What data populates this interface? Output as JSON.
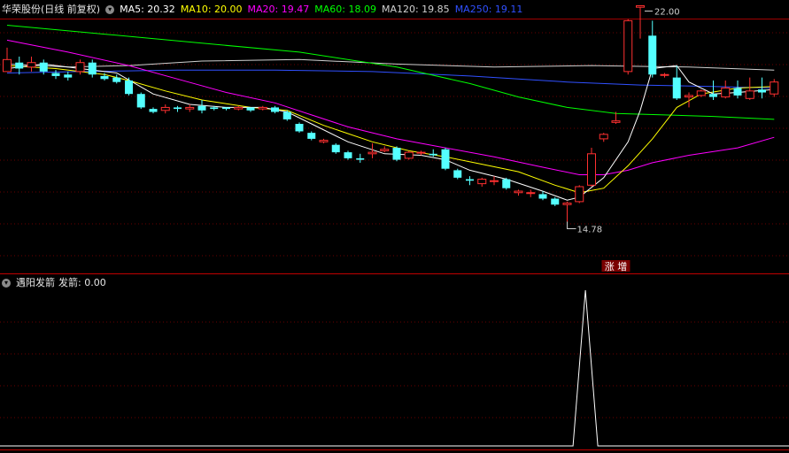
{
  "header": {
    "title": "华荣股份(日线 前复权)",
    "ma": [
      {
        "label": "MA5: 20.32",
        "color": "#ffffff"
      },
      {
        "label": "MA10: 20.00",
        "color": "#ffff00"
      },
      {
        "label": "MA20: 19.47",
        "color": "#ff00ff"
      },
      {
        "label": "MA60: 18.09",
        "color": "#00ff00"
      },
      {
        "label": "MA120: 19.85",
        "color": "#d0d0d0"
      },
      {
        "label": "MA250: 19.11",
        "color": "#3050ff"
      }
    ]
  },
  "sub_header": {
    "name": "遇阳发箭",
    "value_label": "发箭: 0.00"
  },
  "chart_data": [
    {
      "type": "candlestick",
      "annotations": {
        "high": "22.00",
        "low": "14.78",
        "signal": "涨 增"
      },
      "colors": {
        "up": "#ff3030",
        "down": "#54ffff",
        "ma5": "#ffffff",
        "ma10": "#ffff00",
        "ma20": "#ff00ff",
        "ma60": "#00ff00",
        "ma120": "#d0d0d0",
        "ma250": "#3050ff"
      },
      "candles": [
        [
          19.8,
          20.2,
          19.9,
          20.6
        ],
        [
          20.1,
          19.9,
          19.7,
          20.3
        ],
        [
          19.95,
          20.1,
          19.8,
          20.3
        ],
        [
          20.1,
          19.8,
          19.7,
          20.2
        ],
        [
          19.75,
          19.65,
          19.55,
          19.85
        ],
        [
          19.7,
          19.6,
          19.5,
          19.8
        ],
        [
          19.8,
          20.1,
          19.7,
          20.2
        ],
        [
          20.1,
          19.7,
          19.6,
          20.2
        ],
        [
          19.65,
          19.55,
          19.5,
          19.75
        ],
        [
          19.6,
          19.45,
          19.4,
          19.7
        ],
        [
          19.5,
          19.05,
          19.0,
          19.6
        ],
        [
          19.05,
          18.6,
          18.55,
          19.1
        ],
        [
          18.55,
          18.45,
          18.4,
          18.6
        ],
        [
          18.5,
          18.6,
          18.4,
          18.7
        ],
        [
          18.6,
          18.55,
          18.45,
          18.65
        ],
        [
          18.55,
          18.6,
          18.45,
          18.7
        ],
        [
          18.65,
          18.5,
          18.4,
          18.85
        ],
        [
          18.6,
          18.55,
          18.5,
          18.65
        ],
        [
          18.6,
          18.55,
          18.5,
          18.6
        ],
        [
          18.55,
          18.6,
          18.5,
          18.65
        ],
        [
          18.6,
          18.5,
          18.45,
          18.6
        ],
        [
          18.55,
          18.6,
          18.5,
          18.65
        ],
        [
          18.6,
          18.45,
          18.4,
          18.65
        ],
        [
          18.45,
          18.2,
          18.15,
          18.5
        ],
        [
          18.05,
          17.8,
          17.75,
          18.1
        ],
        [
          17.75,
          17.55,
          17.5,
          17.8
        ],
        [
          17.45,
          17.5,
          17.4,
          17.55
        ],
        [
          17.35,
          17.1,
          17.05,
          17.4
        ],
        [
          17.1,
          16.9,
          16.85,
          17.15
        ],
        [
          16.9,
          16.85,
          16.75,
          17.05
        ],
        [
          17.05,
          17.1,
          16.9,
          17.4
        ],
        [
          17.15,
          17.2,
          17.1,
          17.3
        ],
        [
          17.25,
          16.85,
          16.8,
          17.3
        ],
        [
          16.9,
          17.1,
          16.85,
          17.15
        ],
        [
          17.1,
          17.1,
          17.0,
          17.15
        ],
        [
          17.05,
          17.0,
          16.95,
          17.2
        ],
        [
          17.2,
          16.55,
          16.5,
          17.25
        ],
        [
          16.5,
          16.25,
          16.2,
          16.55
        ],
        [
          16.2,
          16.15,
          16.0,
          16.3
        ],
        [
          16.05,
          16.2,
          15.95,
          16.25
        ],
        [
          16.15,
          16.15,
          16.0,
          16.3
        ],
        [
          16.2,
          15.9,
          15.85,
          16.25
        ],
        [
          15.75,
          15.8,
          15.65,
          15.85
        ],
        [
          15.75,
          15.75,
          15.6,
          15.85
        ],
        [
          15.7,
          15.55,
          15.5,
          15.8
        ],
        [
          15.55,
          15.35,
          15.3,
          15.6
        ],
        [
          15.35,
          15.4,
          14.78,
          15.45
        ],
        [
          15.45,
          15.95,
          15.4,
          16.0
        ],
        [
          16.0,
          17.05,
          15.95,
          17.25
        ],
        [
          17.55,
          17.7,
          17.45,
          17.75
        ],
        [
          18.1,
          18.15,
          18.05,
          18.45
        ],
        [
          19.8,
          21.5,
          19.7,
          21.55
        ],
        [
          21.95,
          22.0,
          20.9,
          22.0
        ],
        [
          21.0,
          19.7,
          19.6,
          21.5
        ],
        [
          19.7,
          19.7,
          19.6,
          19.75
        ],
        [
          19.6,
          18.9,
          18.85,
          20.0
        ],
        [
          18.95,
          19.0,
          18.6,
          19.1
        ],
        [
          19.0,
          19.15,
          18.95,
          19.2
        ],
        [
          19.05,
          18.95,
          18.85,
          19.5
        ],
        [
          18.95,
          19.25,
          18.9,
          19.5
        ],
        [
          19.25,
          19.0,
          18.9,
          19.5
        ],
        [
          18.9,
          19.15,
          18.85,
          19.6
        ],
        [
          19.2,
          19.1,
          18.9,
          19.6
        ],
        [
          19.05,
          19.45,
          18.95,
          19.55
        ]
      ],
      "ma5": [
        [
          0,
          19.9
        ],
        [
          3,
          20.05
        ],
        [
          6,
          19.9
        ],
        [
          9,
          19.75
        ],
        [
          12,
          19.05
        ],
        [
          15,
          18.7
        ],
        [
          18,
          18.6
        ],
        [
          21,
          18.6
        ],
        [
          23,
          18.45
        ],
        [
          25,
          18.05
        ],
        [
          28,
          17.45
        ],
        [
          31,
          17.05
        ],
        [
          34,
          17.0
        ],
        [
          36,
          16.85
        ],
        [
          38,
          16.5
        ],
        [
          41,
          16.2
        ],
        [
          44,
          15.8
        ],
        [
          46,
          15.5
        ],
        [
          47,
          15.6
        ],
        [
          49,
          16.25
        ],
        [
          51,
          17.45
        ],
        [
          52,
          18.5
        ],
        [
          53,
          19.9
        ],
        [
          55,
          20.0
        ],
        [
          56,
          19.45
        ],
        [
          58,
          19.05
        ],
        [
          60,
          19.1
        ],
        [
          63,
          19.2
        ]
      ],
      "ma10": [
        [
          0,
          20.0
        ],
        [
          4,
          19.9
        ],
        [
          8,
          19.7
        ],
        [
          10,
          19.5
        ],
        [
          13,
          19.15
        ],
        [
          16,
          18.85
        ],
        [
          20,
          18.6
        ],
        [
          23,
          18.5
        ],
        [
          26,
          18.0
        ],
        [
          30,
          17.45
        ],
        [
          33,
          17.15
        ],
        [
          36,
          16.95
        ],
        [
          39,
          16.7
        ],
        [
          42,
          16.45
        ],
        [
          45,
          16.0
        ],
        [
          47,
          15.75
        ],
        [
          49,
          15.9
        ],
        [
          51,
          16.65
        ],
        [
          53,
          17.55
        ],
        [
          55,
          18.6
        ],
        [
          57,
          19.05
        ],
        [
          60,
          19.25
        ],
        [
          63,
          19.3
        ]
      ],
      "ma20": [
        [
          0,
          20.85
        ],
        [
          5,
          20.45
        ],
        [
          10,
          20.0
        ],
        [
          14,
          19.55
        ],
        [
          18,
          19.1
        ],
        [
          22,
          18.75
        ],
        [
          25,
          18.35
        ],
        [
          28,
          17.95
        ],
        [
          32,
          17.55
        ],
        [
          36,
          17.25
        ],
        [
          40,
          16.95
        ],
        [
          44,
          16.6
        ],
        [
          47,
          16.35
        ],
        [
          49,
          16.35
        ],
        [
          51,
          16.5
        ],
        [
          53,
          16.75
        ],
        [
          56,
          17.0
        ],
        [
          60,
          17.25
        ],
        [
          63,
          17.6
        ]
      ],
      "ma60": [
        [
          0,
          21.35
        ],
        [
          8,
          21.05
        ],
        [
          16,
          20.75
        ],
        [
          24,
          20.45
        ],
        [
          32,
          19.95
        ],
        [
          38,
          19.4
        ],
        [
          42,
          18.95
        ],
        [
          46,
          18.6
        ],
        [
          50,
          18.4
        ],
        [
          54,
          18.35
        ],
        [
          58,
          18.3
        ],
        [
          63,
          18.2
        ]
      ],
      "ma120": [
        [
          0,
          20.05
        ],
        [
          5,
          19.95
        ],
        [
          10,
          20.0
        ],
        [
          16,
          20.15
        ],
        [
          24,
          20.2
        ],
        [
          32,
          20.05
        ],
        [
          40,
          19.95
        ],
        [
          48,
          20.0
        ],
        [
          56,
          19.95
        ],
        [
          63,
          19.85
        ]
      ],
      "ma250": [
        [
          0,
          19.75
        ],
        [
          6,
          19.8
        ],
        [
          14,
          19.85
        ],
        [
          22,
          19.85
        ],
        [
          30,
          19.8
        ],
        [
          38,
          19.65
        ],
        [
          46,
          19.45
        ],
        [
          52,
          19.35
        ],
        [
          58,
          19.3
        ],
        [
          63,
          19.25
        ]
      ]
    },
    {
      "type": "line",
      "name": "发箭",
      "spike": {
        "x": 47.5,
        "y": 1.0
      },
      "ylim": [
        0,
        1
      ]
    }
  ]
}
